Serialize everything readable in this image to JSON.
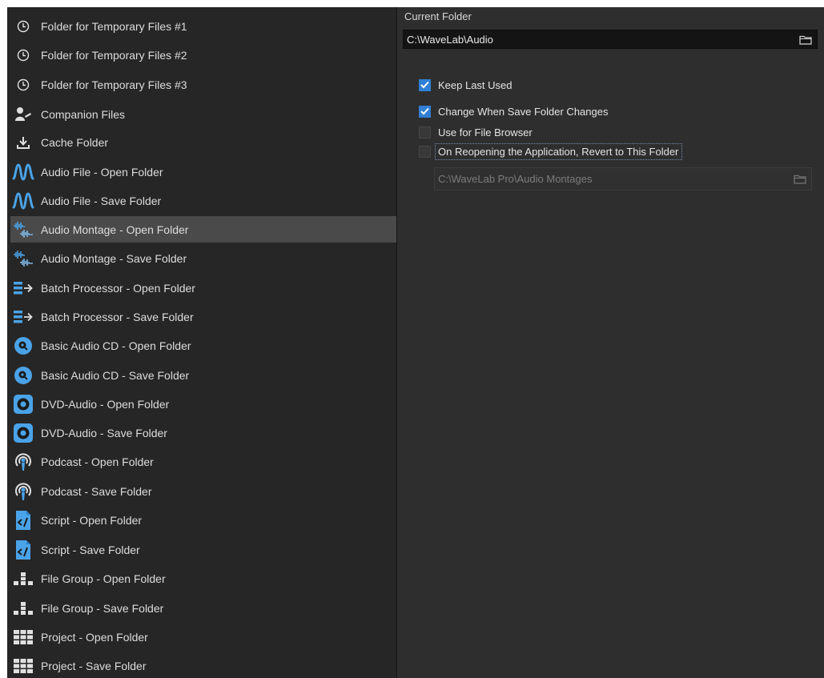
{
  "sidebar": {
    "items": [
      {
        "label": "Folder for Temporary Files #1",
        "icon": "clock-icon"
      },
      {
        "label": "Folder for Temporary Files #2",
        "icon": "clock-icon"
      },
      {
        "label": "Folder for Temporary Files #3",
        "icon": "clock-icon"
      },
      {
        "label": "Companion Files",
        "icon": "companion-files-icon"
      },
      {
        "label": "Cache Folder",
        "icon": "download-icon"
      },
      {
        "label": "Audio File - Open Folder",
        "icon": "waveform-icon"
      },
      {
        "label": "Audio File - Save Folder",
        "icon": "waveform-icon"
      },
      {
        "label": "Audio Montage - Open Folder",
        "icon": "audio-montage-icon"
      },
      {
        "label": "Audio Montage - Save Folder",
        "icon": "audio-montage-icon"
      },
      {
        "label": "Batch Processor - Open Folder",
        "icon": "batch-processor-icon"
      },
      {
        "label": "Batch Processor - Save Folder",
        "icon": "batch-processor-icon"
      },
      {
        "label": "Basic Audio CD - Open Folder",
        "icon": "cd-icon"
      },
      {
        "label": "Basic Audio CD - Save Folder",
        "icon": "cd-icon"
      },
      {
        "label": "DVD-Audio - Open Folder",
        "icon": "dvd-icon"
      },
      {
        "label": "DVD-Audio - Save Folder",
        "icon": "dvd-icon"
      },
      {
        "label": "Podcast - Open Folder",
        "icon": "podcast-icon"
      },
      {
        "label": "Podcast - Save Folder",
        "icon": "podcast-icon"
      },
      {
        "label": "Script - Open Folder",
        "icon": "script-icon"
      },
      {
        "label": "Script - Save Folder",
        "icon": "script-icon"
      },
      {
        "label": "File Group - Open Folder",
        "icon": "file-group-icon"
      },
      {
        "label": "File Group - Save Folder",
        "icon": "file-group-icon"
      },
      {
        "label": "Project - Open Folder",
        "icon": "project-grid-icon"
      },
      {
        "label": "Project - Save Folder",
        "icon": "project-grid-icon"
      }
    ],
    "selected_index": 7
  },
  "main": {
    "current_folder_label": "Current Folder",
    "current_folder_value": "C:\\WaveLab\\Audio",
    "options": [
      {
        "label": "Keep Last Used",
        "checked": true
      },
      {
        "label": "Change When Save Folder Changes",
        "checked": true
      },
      {
        "label": "Use for File Browser",
        "checked": false
      }
    ],
    "revert_option": {
      "label": "On Reopening the Application, Revert to This Folder",
      "checked": false
    },
    "revert_path": "C:\\WaveLab Pro\\Audio Montages"
  },
  "colors": {
    "accent_blue": "#4aa3e8",
    "checkbox_blue": "#2f7fd4",
    "selected_row": "#4a4a4a"
  }
}
